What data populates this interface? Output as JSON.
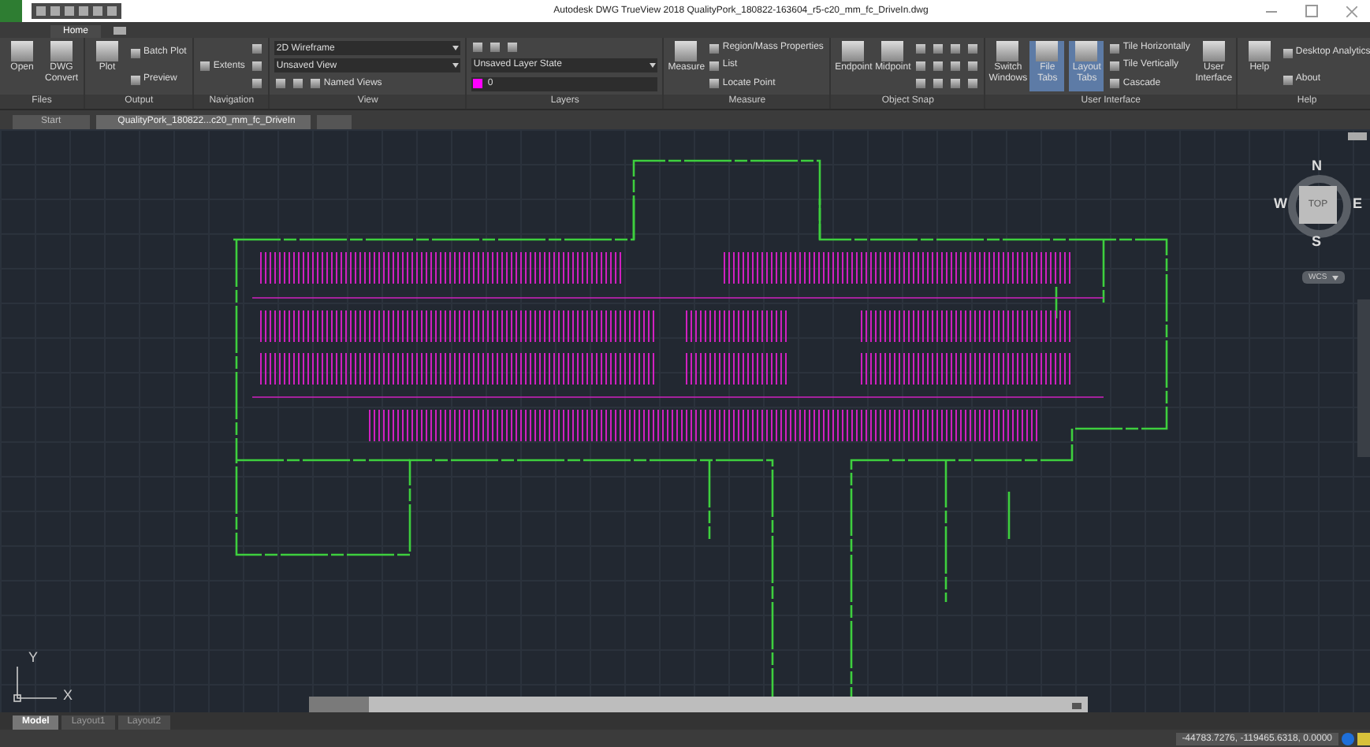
{
  "window": {
    "title": "Autodesk DWG TrueView 2018   QualityPork_180822-163604_r5-c20_mm_fc_DriveIn.dwg"
  },
  "ribbon": {
    "tabs": [
      {
        "label": "Home",
        "selected": true
      }
    ],
    "panels": [
      {
        "title": "Files",
        "columns": [
          [
            [
              {
                "kind": "large",
                "label": "Open"
              }
            ]
          ],
          [
            [
              {
                "kind": "large",
                "label": "DWG Convert"
              }
            ]
          ]
        ]
      },
      {
        "title": "Output",
        "columns": [
          [
            [
              {
                "kind": "large",
                "label": "Plot"
              }
            ]
          ],
          [
            [
              {
                "kind": "small",
                "label": "Batch Plot"
              }
            ],
            [
              {
                "kind": "small",
                "label": "Preview"
              }
            ]
          ]
        ]
      },
      {
        "title": "Navigation",
        "columns": [
          [
            [
              {
                "kind": "small",
                "label": "Extents"
              }
            ]
          ],
          [
            [
              {
                "kind": "icon"
              }
            ],
            [
              {
                "kind": "icon"
              }
            ],
            [
              {
                "kind": "icon"
              }
            ]
          ]
        ]
      },
      {
        "title": "View",
        "columns": [
          [
            [
              {
                "kind": "combo",
                "value": "2D Wireframe"
              }
            ],
            [
              {
                "kind": "combo",
                "value": "Unsaved View"
              }
            ],
            [
              {
                "kind": "icon"
              },
              {
                "kind": "icon"
              },
              {
                "kind": "small",
                "label": "Named Views"
              }
            ]
          ]
        ]
      },
      {
        "title": "Layers",
        "columns": [
          [
            [
              {
                "kind": "icon"
              },
              {
                "kind": "icon"
              },
              {
                "kind": "icon"
              }
            ],
            [
              {
                "kind": "combo",
                "value": "Unsaved Layer State"
              }
            ],
            [
              {
                "kind": "layer",
                "value": "0",
                "color": "#ff00ff"
              }
            ]
          ]
        ]
      },
      {
        "title": "Measure",
        "columns": [
          [
            [
              {
                "kind": "large",
                "label": "Measure"
              }
            ]
          ],
          [
            [
              {
                "kind": "small",
                "label": "Region/Mass Properties"
              }
            ],
            [
              {
                "kind": "small",
                "label": "List"
              }
            ],
            [
              {
                "kind": "small",
                "label": "Locate Point"
              }
            ]
          ]
        ]
      },
      {
        "title": "Object Snap",
        "columns": [
          [
            [
              {
                "kind": "large",
                "label": "Endpoint"
              }
            ]
          ],
          [
            [
              {
                "kind": "large",
                "label": "Midpoint"
              }
            ]
          ],
          [
            [
              {
                "kind": "icon"
              },
              {
                "kind": "icon"
              },
              {
                "kind": "icon"
              },
              {
                "kind": "icon"
              }
            ],
            [
              {
                "kind": "icon"
              },
              {
                "kind": "icon"
              },
              {
                "kind": "icon"
              },
              {
                "kind": "icon"
              }
            ],
            [
              {
                "kind": "icon"
              },
              {
                "kind": "icon"
              },
              {
                "kind": "icon"
              },
              {
                "kind": "icon"
              }
            ]
          ]
        ]
      },
      {
        "title": "User Interface",
        "columns": [
          [
            [
              {
                "kind": "large",
                "label": "Switch Windows",
                "on": false
              }
            ]
          ],
          [
            [
              {
                "kind": "large",
                "label": "File Tabs",
                "on": true
              }
            ]
          ],
          [
            [
              {
                "kind": "large",
                "label": "Layout Tabs",
                "on": true
              }
            ]
          ],
          [
            [
              {
                "kind": "small",
                "label": "Tile Horizontally"
              }
            ],
            [
              {
                "kind": "small",
                "label": "Tile Vertically"
              }
            ],
            [
              {
                "kind": "small",
                "label": "Cascade"
              }
            ]
          ],
          [
            [
              {
                "kind": "large",
                "label": "User Interface",
                "on": false
              }
            ]
          ]
        ]
      },
      {
        "title": "Help",
        "columns": [
          [
            [
              {
                "kind": "large",
                "label": "Help"
              }
            ]
          ],
          [
            [
              {
                "kind": "small",
                "label": "Desktop Analytics"
              }
            ],
            [
              {
                "kind": "small",
                "label": "About"
              }
            ]
          ]
        ]
      }
    ]
  },
  "file_tabs": [
    {
      "label": "Start",
      "selected": false
    },
    {
      "label": "QualityPork_180822...c20_mm_fc_DriveIn",
      "selected": true
    }
  ],
  "viewcube": {
    "north": "N",
    "south": "S",
    "east": "E",
    "west": "W",
    "face": "TOP",
    "ucs": "WCS"
  },
  "axes": {
    "x": "X",
    "y": "Y"
  },
  "layout_tabs": [
    {
      "label": "Model",
      "selected": true
    },
    {
      "label": "Layout1",
      "selected": false
    },
    {
      "label": "Layout2",
      "selected": false
    }
  ],
  "status_bar": {
    "coordinates": "-44783.7276, -119465.6318, 0.0000"
  }
}
